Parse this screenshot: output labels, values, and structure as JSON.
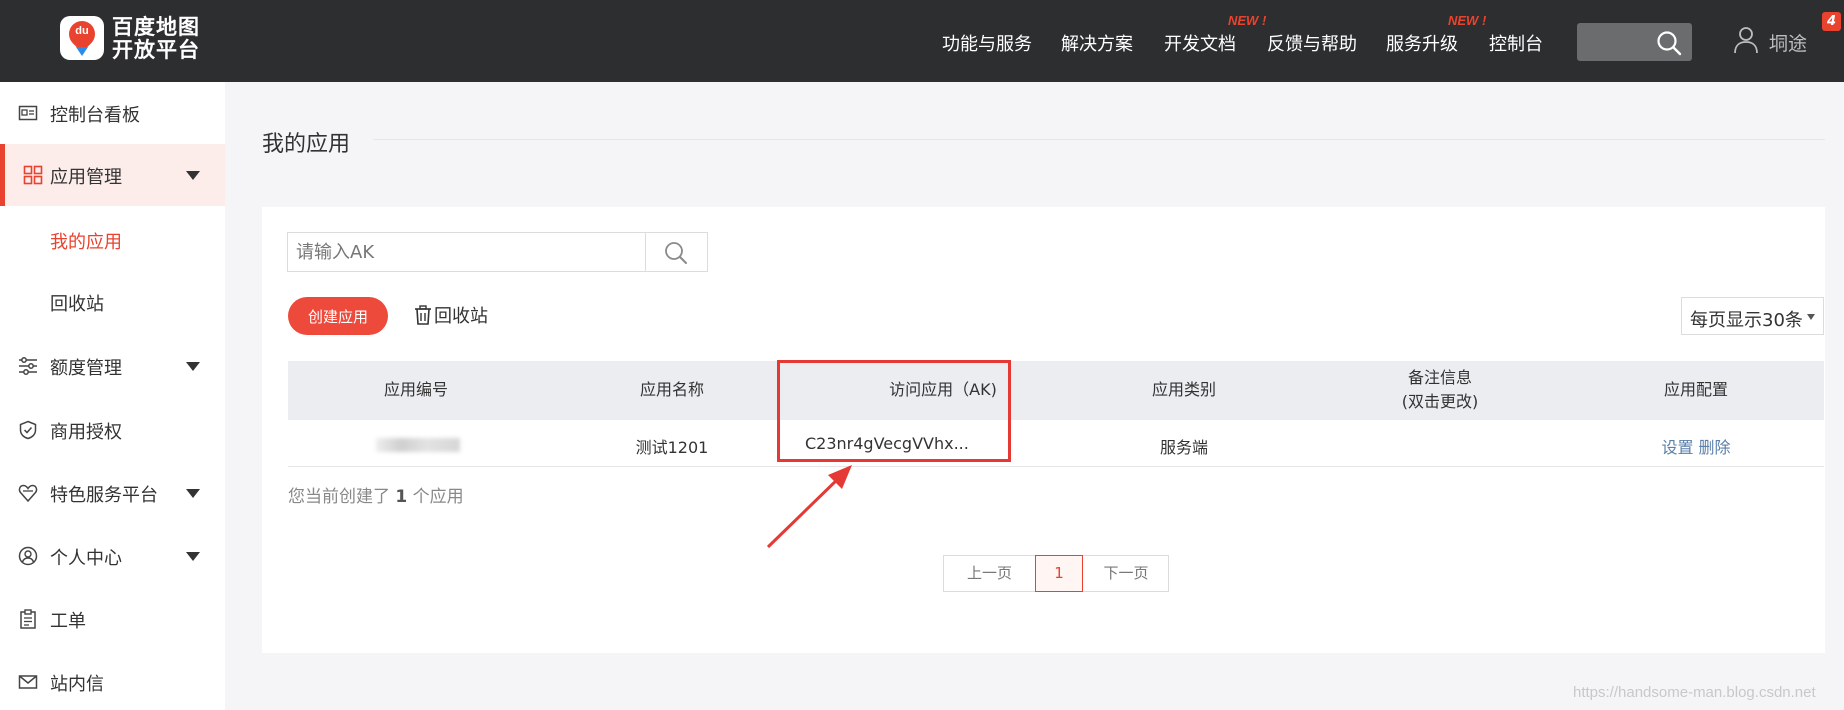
{
  "header": {
    "logo_text_line1": "百度地图",
    "logo_text_line2": "开放平台",
    "logo_mark_text": "du",
    "nav": [
      {
        "label": "功能与服务"
      },
      {
        "label": "解决方案"
      },
      {
        "label": "开发文档",
        "badge": "NEW !"
      },
      {
        "label": "反馈与帮助"
      },
      {
        "label": "服务升级",
        "badge": "NEW !"
      },
      {
        "label": "控制台"
      }
    ],
    "username": "垌途",
    "notification_count": "4"
  },
  "sidebar": {
    "items": [
      {
        "label": "控制台看板",
        "icon": "dashboard-card-icon"
      },
      {
        "label": "应用管理",
        "icon": "grid-icon",
        "expanded": true,
        "active": true
      },
      {
        "label": "额度管理",
        "icon": "sliders-icon"
      },
      {
        "label": "商用授权",
        "icon": "shield-check-icon"
      },
      {
        "label": "特色服务平台",
        "icon": "heart-icon"
      },
      {
        "label": "个人中心",
        "icon": "user-circle-icon"
      },
      {
        "label": "工单",
        "icon": "clipboard-icon"
      },
      {
        "label": "站内信",
        "icon": "mail-icon"
      }
    ],
    "subitems": [
      {
        "label": "我的应用",
        "current": true
      },
      {
        "label": "回收站"
      }
    ]
  },
  "main": {
    "title": "我的应用",
    "search_placeholder": "请输入AK",
    "create_button": "创建应用",
    "recycle_link": "回收站",
    "per_page": "每页显示30条",
    "table": {
      "headers": [
        "应用编号",
        "应用名称",
        "访问应用（AK)",
        "应用类别",
        "备注信息",
        "(双击更改)",
        "应用配置"
      ],
      "rows": [
        {
          "name": "测试1201",
          "ak": "C23nr4gVecgVVhx...",
          "category": "服务端",
          "note": "",
          "action_settings": "设置",
          "action_delete": "删除"
        }
      ]
    },
    "count_prefix": "您当前创建了",
    "count_value": "1",
    "count_suffix": "个应用",
    "pager": {
      "prev": "上一页",
      "current": "1",
      "next": "下一页"
    }
  },
  "watermark": "https://handsome-man.blog.csdn.net",
  "colors": {
    "brand": "#e9432f",
    "topbar": "#2c2e2f",
    "annotation": "#e53935"
  }
}
